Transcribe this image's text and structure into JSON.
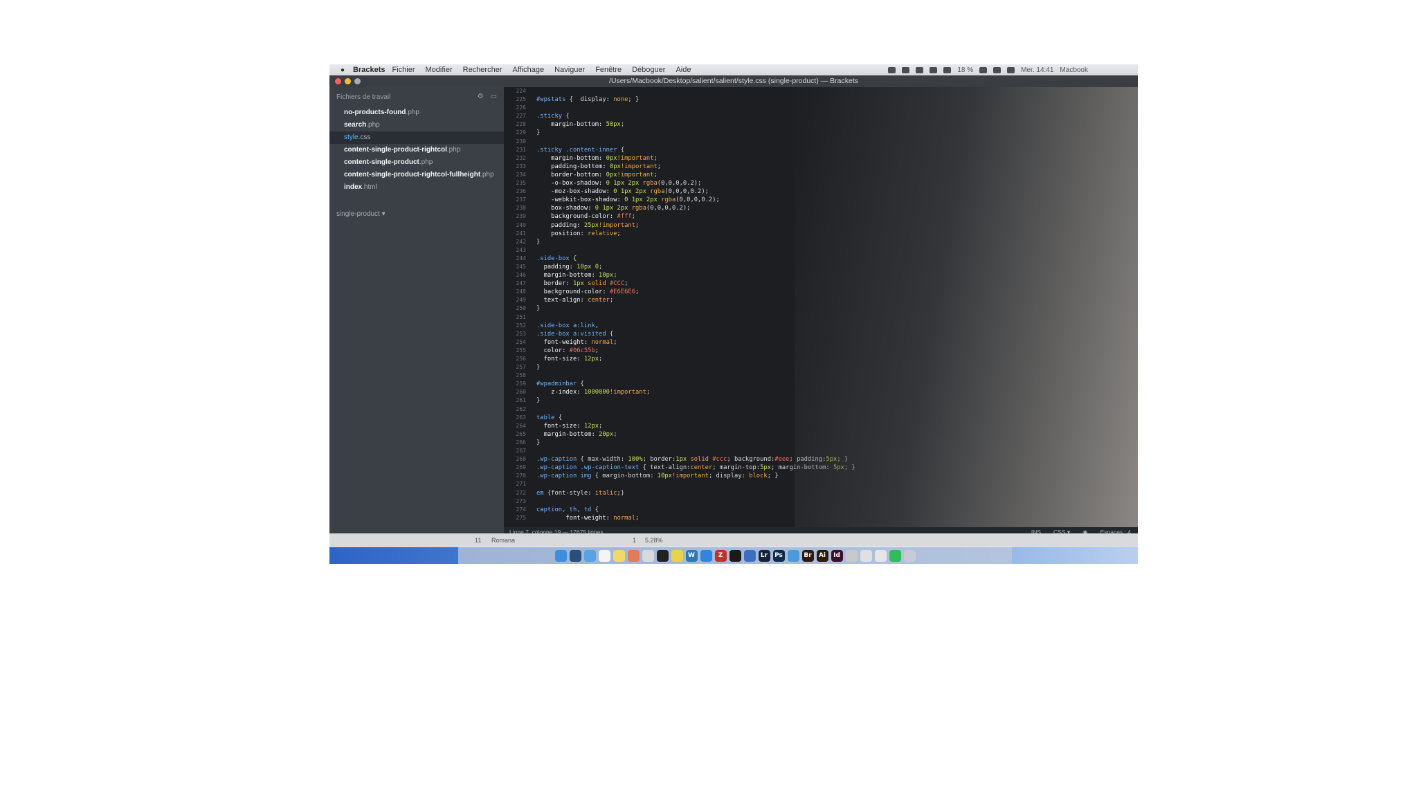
{
  "menubar": {
    "apple": "",
    "app": "Brackets",
    "items": [
      "Fichier",
      "Modifier",
      "Rechercher",
      "Affichage",
      "Naviguer",
      "Fenêtre",
      "Déboguer",
      "Aide"
    ],
    "battery": "18 %",
    "clock": "Mer. 14:41",
    "user": "Macbook"
  },
  "window": {
    "title": "/Users/Macbook/Desktop/salient/salient/style.css (single-product) — Brackets"
  },
  "sidebar": {
    "header": "Fichiers de travail",
    "files": [
      {
        "name": "no-products-found",
        "ext": ".php",
        "active": false
      },
      {
        "name": "search",
        "ext": ".php",
        "active": false
      },
      {
        "name": "style",
        "ext": ".css",
        "active": true
      },
      {
        "name": "content-single-product-rightcol",
        "ext": ".php",
        "active": false
      },
      {
        "name": "content-single-product",
        "ext": ".php",
        "active": false
      },
      {
        "name": "content-single-product-rightcol-fullheight",
        "ext": ".php",
        "active": false
      },
      {
        "name": "index",
        "ext": ".html",
        "active": false
      }
    ],
    "project": "single-product ▾"
  },
  "editor": {
    "lines": [
      {
        "n": "224",
        "tokens": []
      },
      {
        "n": "225",
        "tokens": [
          [
            "sel",
            "#wpstats"
          ],
          [
            "pun",
            " {  display: "
          ],
          [
            "val",
            "none"
          ],
          [
            "pun",
            "; }"
          ]
        ]
      },
      {
        "n": "226",
        "tokens": []
      },
      {
        "n": "227",
        "tokens": [
          [
            "sel",
            ".sticky"
          ],
          [
            "pun",
            " {"
          ]
        ]
      },
      {
        "n": "228",
        "tokens": [
          [
            "prop",
            "    margin-bottom: "
          ],
          [
            "num",
            "50px"
          ],
          [
            "pun",
            ";"
          ]
        ]
      },
      {
        "n": "229",
        "tokens": [
          [
            "pun",
            "}"
          ]
        ]
      },
      {
        "n": "230",
        "tokens": []
      },
      {
        "n": "231",
        "tokens": [
          [
            "sel",
            ".sticky .content-inner"
          ],
          [
            "pun",
            " {"
          ]
        ]
      },
      {
        "n": "232",
        "tokens": [
          [
            "prop",
            "    margin-bottom: "
          ],
          [
            "num",
            "0px"
          ],
          [
            "val",
            "!important"
          ],
          [
            "pun",
            ";"
          ]
        ]
      },
      {
        "n": "233",
        "tokens": [
          [
            "prop",
            "    padding-bottom: "
          ],
          [
            "num",
            "0px"
          ],
          [
            "val",
            "!important"
          ],
          [
            "pun",
            ";"
          ]
        ]
      },
      {
        "n": "234",
        "tokens": [
          [
            "prop",
            "    border-bottom: "
          ],
          [
            "num",
            "0px"
          ],
          [
            "val",
            "!important"
          ],
          [
            "pun",
            ";"
          ]
        ]
      },
      {
        "n": "235",
        "tokens": [
          [
            "prop",
            "    -o-box-shadow: "
          ],
          [
            "num",
            "0 1px 2px "
          ],
          [
            "val",
            "rgba"
          ],
          [
            "pun",
            "(0,0,0,0.2);"
          ]
        ]
      },
      {
        "n": "236",
        "tokens": [
          [
            "prop",
            "    -moz-box-shadow: "
          ],
          [
            "num",
            "0 1px 2px "
          ],
          [
            "val",
            "rgba"
          ],
          [
            "pun",
            "(0,0,0,0.2);"
          ]
        ]
      },
      {
        "n": "237",
        "tokens": [
          [
            "prop",
            "    -webkit-box-shadow: "
          ],
          [
            "num",
            "0 1px 2px "
          ],
          [
            "val",
            "rgba"
          ],
          [
            "pun",
            "(0,0,0,0.2);"
          ]
        ]
      },
      {
        "n": "238",
        "tokens": [
          [
            "prop",
            "    box-shadow: "
          ],
          [
            "num",
            "0 1px 2px "
          ],
          [
            "val",
            "rgba"
          ],
          [
            "pun",
            "(0,0,0,0.2);"
          ]
        ]
      },
      {
        "n": "239",
        "tokens": [
          [
            "prop",
            "    background-color: "
          ],
          [
            "hex",
            "#fff"
          ],
          [
            "pun",
            ";"
          ]
        ]
      },
      {
        "n": "240",
        "tokens": [
          [
            "prop",
            "    padding: "
          ],
          [
            "num",
            "25px"
          ],
          [
            "val",
            "!important"
          ],
          [
            "pun",
            ";"
          ]
        ]
      },
      {
        "n": "241",
        "tokens": [
          [
            "prop",
            "    position: "
          ],
          [
            "val",
            "relative"
          ],
          [
            "pun",
            ";"
          ]
        ]
      },
      {
        "n": "242",
        "tokens": [
          [
            "pun",
            "}"
          ]
        ]
      },
      {
        "n": "243",
        "tokens": []
      },
      {
        "n": "244",
        "tokens": [
          [
            "sel",
            ".side-box"
          ],
          [
            "pun",
            " {"
          ]
        ]
      },
      {
        "n": "245",
        "tokens": [
          [
            "prop",
            "  padding: "
          ],
          [
            "num",
            "10px 0"
          ],
          [
            "pun",
            ";"
          ]
        ]
      },
      {
        "n": "246",
        "tokens": [
          [
            "prop",
            "  margin-bottom: "
          ],
          [
            "num",
            "10px"
          ],
          [
            "pun",
            ";"
          ]
        ]
      },
      {
        "n": "247",
        "tokens": [
          [
            "prop",
            "  border: "
          ],
          [
            "num",
            "1px "
          ],
          [
            "val",
            "solid "
          ],
          [
            "hex",
            "#CCC"
          ],
          [
            "pun",
            ";"
          ]
        ]
      },
      {
        "n": "248",
        "tokens": [
          [
            "prop",
            "  background-color: "
          ],
          [
            "hex",
            "#E6E6E6"
          ],
          [
            "pun",
            ";"
          ]
        ]
      },
      {
        "n": "249",
        "tokens": [
          [
            "prop",
            "  text-align: "
          ],
          [
            "val",
            "center"
          ],
          [
            "pun",
            ";"
          ]
        ]
      },
      {
        "n": "250",
        "tokens": [
          [
            "pun",
            "}"
          ]
        ]
      },
      {
        "n": "251",
        "tokens": []
      },
      {
        "n": "252",
        "tokens": [
          [
            "sel",
            ".side-box a:link"
          ],
          [
            "pun",
            ","
          ]
        ]
      },
      {
        "n": "253",
        "tokens": [
          [
            "sel",
            ".side-box a:visited"
          ],
          [
            "pun",
            " {"
          ]
        ]
      },
      {
        "n": "254",
        "tokens": [
          [
            "prop",
            "  font-weight: "
          ],
          [
            "val",
            "normal"
          ],
          [
            "pun",
            ";"
          ]
        ]
      },
      {
        "n": "255",
        "tokens": [
          [
            "prop",
            "  color: "
          ],
          [
            "hex",
            "#06c55b"
          ],
          [
            "pun",
            ";"
          ]
        ]
      },
      {
        "n": "256",
        "tokens": [
          [
            "prop",
            "  font-size: "
          ],
          [
            "num",
            "12px"
          ],
          [
            "pun",
            ";"
          ]
        ]
      },
      {
        "n": "257",
        "tokens": [
          [
            "pun",
            "}"
          ]
        ]
      },
      {
        "n": "258",
        "tokens": []
      },
      {
        "n": "259",
        "tokens": [
          [
            "sel",
            "#wpadminbar"
          ],
          [
            "pun",
            " {"
          ]
        ]
      },
      {
        "n": "260",
        "tokens": [
          [
            "prop",
            "    z-index: "
          ],
          [
            "num",
            "1000000"
          ],
          [
            "val",
            "!important"
          ],
          [
            "pun",
            ";"
          ]
        ]
      },
      {
        "n": "261",
        "tokens": [
          [
            "pun",
            "}"
          ]
        ]
      },
      {
        "n": "262",
        "tokens": []
      },
      {
        "n": "263",
        "tokens": [
          [
            "sel",
            "table"
          ],
          [
            "pun",
            " {"
          ]
        ]
      },
      {
        "n": "264",
        "tokens": [
          [
            "prop",
            "  font-size: "
          ],
          [
            "num",
            "12px"
          ],
          [
            "pun",
            ";"
          ]
        ]
      },
      {
        "n": "265",
        "tokens": [
          [
            "prop",
            "  margin-bottom: "
          ],
          [
            "num",
            "20px"
          ],
          [
            "pun",
            ";"
          ]
        ]
      },
      {
        "n": "266",
        "tokens": [
          [
            "pun",
            "}"
          ]
        ]
      },
      {
        "n": "267",
        "tokens": []
      },
      {
        "n": "268",
        "tokens": [
          [
            "sel",
            ".wp-caption"
          ],
          [
            "pun",
            " { max-width: "
          ],
          [
            "num",
            "100%"
          ],
          [
            "pun",
            "; border:"
          ],
          [
            "num",
            "1px "
          ],
          [
            "val",
            "solid "
          ],
          [
            "hex",
            "#ccc"
          ],
          [
            "pun",
            "; background:"
          ],
          [
            "hex",
            "#eee"
          ],
          [
            "pun",
            "; padding:"
          ],
          [
            "num",
            "5px"
          ],
          [
            "pun",
            "; }"
          ]
        ]
      },
      {
        "n": "269",
        "tokens": [
          [
            "sel",
            ".wp-caption .wp-caption-text"
          ],
          [
            "pun",
            " { text-align:"
          ],
          [
            "val",
            "center"
          ],
          [
            "pun",
            "; margin-top:"
          ],
          [
            "num",
            "5px"
          ],
          [
            "pun",
            "; margin-bottom: "
          ],
          [
            "num",
            "5px"
          ],
          [
            "pun",
            "; }"
          ]
        ]
      },
      {
        "n": "270",
        "tokens": [
          [
            "sel",
            ".wp-caption img"
          ],
          [
            "pun",
            " { margin-bottom: "
          ],
          [
            "num",
            "10px"
          ],
          [
            "val",
            "!important"
          ],
          [
            "pun",
            "; display: "
          ],
          [
            "val",
            "block"
          ],
          [
            "pun",
            "; }"
          ]
        ]
      },
      {
        "n": "271",
        "tokens": []
      },
      {
        "n": "272",
        "tokens": [
          [
            "sel",
            "em"
          ],
          [
            "pun",
            " {font-style: "
          ],
          [
            "val",
            "italic"
          ],
          [
            "pun",
            ";}"
          ]
        ]
      },
      {
        "n": "273",
        "tokens": []
      },
      {
        "n": "274",
        "tokens": [
          [
            "sel",
            "caption, th, td"
          ],
          [
            "pun",
            " {"
          ]
        ]
      },
      {
        "n": "275",
        "tokens": [
          [
            "prop",
            "        font-weight: "
          ],
          [
            "val",
            "normal"
          ],
          [
            "pun",
            ";"
          ]
        ]
      }
    ]
  },
  "statusbar": {
    "position": "Ligne 7, colonne 19 — 17675 lignes",
    "ins": "INS",
    "lang": "CSS ▾",
    "spaces": "Espaces : 4"
  },
  "bottomstrip": {
    "col": "11",
    "font": "Romana",
    "page": "1",
    "zoom": "5.28%"
  },
  "dock": {
    "icons": [
      {
        "name": "finder-icon",
        "color": "#3b8fe0",
        "glyph": ""
      },
      {
        "name": "dashboard-icon",
        "color": "#2a4d7a",
        "glyph": ""
      },
      {
        "name": "mail-icon",
        "color": "#5aa2e8",
        "glyph": ""
      },
      {
        "name": "calendar-icon",
        "color": "#f4f4f4",
        "glyph": ""
      },
      {
        "name": "notes-icon",
        "color": "#f0d86a",
        "glyph": ""
      },
      {
        "name": "photos-icon",
        "color": "#e27b5a",
        "glyph": ""
      },
      {
        "name": "files-icon",
        "color": "#d9d9d9",
        "glyph": ""
      },
      {
        "name": "terminal-icon",
        "color": "#222222",
        "glyph": ""
      },
      {
        "name": "chrome-icon",
        "color": "#e8d34a",
        "glyph": ""
      },
      {
        "name": "wordpress-icon",
        "color": "#2b79b9",
        "glyph": "W"
      },
      {
        "name": "safari-icon",
        "color": "#2f85e0",
        "glyph": ""
      },
      {
        "name": "filezilla-icon",
        "color": "#c4302b",
        "glyph": "Z"
      },
      {
        "name": "console-icon",
        "color": "#1a1a1a",
        "glyph": ""
      },
      {
        "name": "brackets-icon",
        "color": "#3b6fbf",
        "glyph": ""
      },
      {
        "name": "lightroom-icon",
        "color": "#17223a",
        "glyph": "Lr"
      },
      {
        "name": "photoshop-icon",
        "color": "#0f2c4d",
        "glyph": "Ps"
      },
      {
        "name": "drive-icon",
        "color": "#4a9ae0",
        "glyph": ""
      },
      {
        "name": "bridge-icon",
        "color": "#2b1b0d",
        "glyph": "Br"
      },
      {
        "name": "illustrator-icon",
        "color": "#2f1a05",
        "glyph": "Ai"
      },
      {
        "name": "indesign-icon",
        "color": "#3a0f28",
        "glyph": "Id"
      },
      {
        "name": "acrobat-icon",
        "color": "#c9c9c9",
        "glyph": ""
      },
      {
        "name": "preview-icon",
        "color": "#e0e0e0",
        "glyph": ""
      },
      {
        "name": "itunes-icon",
        "color": "#e6e6e6",
        "glyph": ""
      },
      {
        "name": "spotify-icon",
        "color": "#2ebd59",
        "glyph": ""
      },
      {
        "name": "trash-icon",
        "color": "#c7ccd4",
        "glyph": ""
      }
    ]
  }
}
